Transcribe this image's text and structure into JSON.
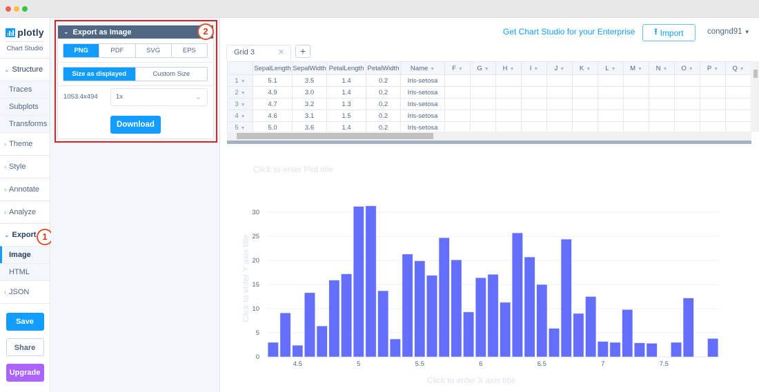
{
  "window": {
    "dots": [
      "#f25f58",
      "#fbbe3c",
      "#33c748"
    ]
  },
  "sidebar": {
    "logo_text": "plotly",
    "logo_sub": "Chart Studio",
    "groups": [
      {
        "label": "Structure",
        "open": true,
        "items": [
          "Traces",
          "Subplots",
          "Transforms"
        ]
      },
      {
        "label": "Theme"
      },
      {
        "label": "Style"
      },
      {
        "label": "Annotate"
      },
      {
        "label": "Analyze"
      },
      {
        "label": "Export",
        "open": true,
        "items": [
          "Image",
          "HTML"
        ],
        "active": "Image"
      },
      {
        "label": "JSON"
      }
    ],
    "save": "Save",
    "share": "Share",
    "upgrade": "Upgrade"
  },
  "export_panel": {
    "title": "Export as Image",
    "formats": [
      "PNG",
      "PDF",
      "SVG",
      "EPS"
    ],
    "selected_format": "PNG",
    "size_modes": [
      "Size as displayed",
      "Custom Size"
    ],
    "selected_size_mode": "Size as displayed",
    "dimensions": "1053.4x494",
    "scale_value": "1x",
    "download": "Download"
  },
  "annotations": {
    "badge1": "1",
    "badge2": "2"
  },
  "topbar": {
    "enterprise_link": "Get Chart Studio for your Enterprise",
    "import": "Import",
    "user": "congnd91"
  },
  "grid": {
    "tab_label": "Grid 3",
    "add_tab": "+",
    "columns": [
      "SepalLength",
      "SepalWidth",
      "PetalLength",
      "PetalWidth",
      "Name",
      "F",
      "G",
      "H",
      "I",
      "J",
      "K",
      "L",
      "M",
      "N",
      "O",
      "P",
      "Q"
    ],
    "rows": [
      [
        "1",
        "5.1",
        "3.5",
        "1.4",
        "0.2",
        "Iris-setosa"
      ],
      [
        "2",
        "4.9",
        "3.0",
        "1.4",
        "0.2",
        "Iris-setosa"
      ],
      [
        "3",
        "4.7",
        "3.2",
        "1.3",
        "0.2",
        "Iris-setosa"
      ],
      [
        "4",
        "4.6",
        "3.1",
        "1.5",
        "0.2",
        "Iris-setosa"
      ],
      [
        "5",
        "5.0",
        "3.6",
        "1.4",
        "0.2",
        "Iris-setosa"
      ]
    ]
  },
  "chart_data": {
    "type": "bar",
    "title": "Click to enter Plot title",
    "xlabel": "Click to enter X axis title",
    "ylabel": "Click to enter Y axis title",
    "x": [
      4.3,
      4.4,
      4.5,
      4.6,
      4.7,
      4.8,
      4.9,
      5.0,
      5.1,
      5.2,
      5.3,
      5.4,
      5.5,
      5.6,
      5.7,
      5.8,
      5.9,
      6.0,
      6.1,
      6.2,
      6.3,
      6.4,
      6.5,
      6.6,
      6.7,
      6.8,
      6.9,
      7.0,
      7.1,
      7.2,
      7.3,
      7.4,
      7.6,
      7.7,
      7.9
    ],
    "values": [
      3.0,
      9.1,
      2.4,
      13.3,
      6.4,
      15.9,
      17.2,
      31.2,
      31.3,
      13.7,
      3.7,
      21.3,
      19.9,
      16.9,
      24.7,
      20.1,
      9.3,
      16.4,
      17.1,
      11.3,
      25.7,
      20.7,
      15.0,
      5.9,
      24.4,
      9.0,
      12.5,
      3.2,
      3.0,
      9.8,
      2.9,
      2.8,
      3.0,
      12.2,
      3.8
    ],
    "xticks": [
      "4.5",
      "5",
      "5.5",
      "6",
      "6.5",
      "7",
      "7.5"
    ],
    "xtick_values": [
      4.5,
      5,
      5.5,
      6,
      6.5,
      7,
      7.5
    ],
    "yticks": [
      "0",
      "5",
      "10",
      "15",
      "20",
      "25",
      "30"
    ],
    "ytick_values": [
      0,
      5,
      10,
      15,
      20,
      25,
      30
    ],
    "xlim": [
      4.25,
      7.95
    ],
    "ylim": [
      0,
      33
    ],
    "grid": true,
    "bar_color": "#636efa"
  }
}
